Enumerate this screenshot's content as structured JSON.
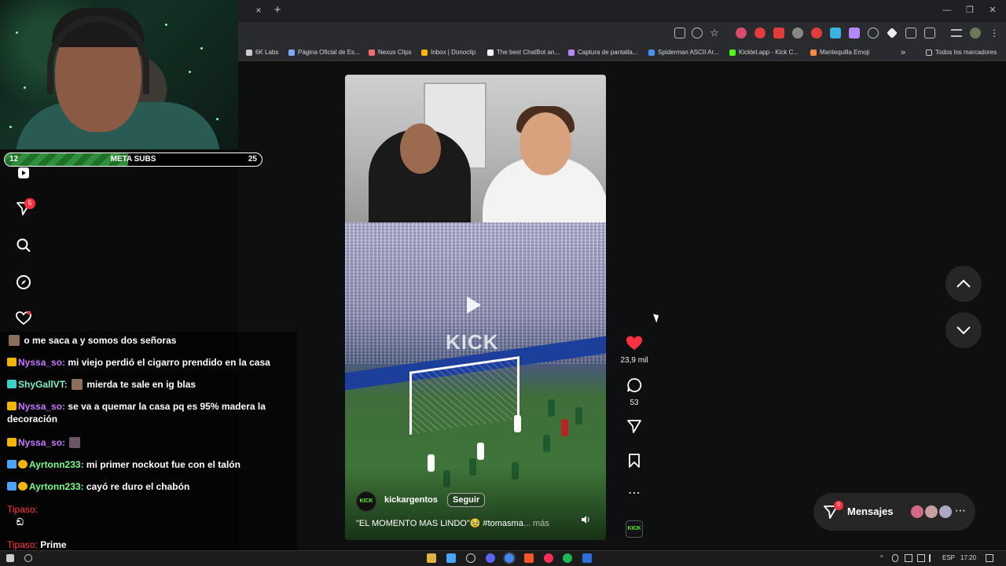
{
  "browser": {
    "tab_close": "×",
    "new_tab": "+",
    "window_controls": [
      "—",
      "❐",
      "✕"
    ],
    "bookmarks": [
      {
        "label": "6K Labs",
        "color": "#cccccc"
      },
      {
        "label": "Página Oficial de Es...",
        "color": "#7aa7ff"
      },
      {
        "label": "Nexus Clips",
        "color": "#ff6b6b"
      },
      {
        "label": "Inbox | Donoclip",
        "color": "#ffb400"
      },
      {
        "label": "The best ChatBot an...",
        "color": "#ffffff"
      },
      {
        "label": "Captura de pantalla...",
        "color": "#b388ff"
      },
      {
        "label": "Spiderman ASCII Ar...",
        "color": "#4a90ff"
      },
      {
        "label": "Kicklet.app - Kick C...",
        "color": "#53fc18"
      },
      {
        "label": "Mantequilla Emoji",
        "color": "#ff8a3d"
      }
    ],
    "bookmarks_overflow": "»",
    "all_bookmarks": "Todos los marcadores"
  },
  "overlay": {
    "meta_subs": {
      "label": "META SUBS",
      "current": "12",
      "goal": "25",
      "progress_fraction": 0.48
    },
    "notifications_badge": "5"
  },
  "chat": {
    "messages": [
      {
        "user": "",
        "user_color": "#ffffff",
        "text": "o me saca a  y somos dos señoras"
      },
      {
        "user": "Nyssa_so:",
        "user_color": "#c678ff",
        "text": "mi viejo perdió el cigarro prendido en la casa"
      },
      {
        "user": "ShyGallVT:",
        "user_color": "#7ef2c6",
        "text": "mierda te sale en ig blas"
      },
      {
        "user": "Nyssa_so:",
        "user_color": "#c678ff",
        "text": "se va a quemar la casa pq es 95% madera la decoración"
      },
      {
        "user": "Nyssa_so:",
        "user_color": "#c678ff",
        "text": ""
      },
      {
        "user": "Ayrtonn233:",
        "user_color": "#7dff8a",
        "text": "mi primer nockout fue con el talón"
      },
      {
        "user": "Ayrtonn233:",
        "user_color": "#7dff8a",
        "text": "cayó re duro el chabón"
      },
      {
        "user": "Tipaso:",
        "user_color": "#ff3b3b",
        "text": "ඞ"
      },
      {
        "user": "Tipaso:",
        "user_color": "#ff3b3b",
        "text": "Prime"
      }
    ]
  },
  "video": {
    "watermark": "KICK",
    "channel_avatar": "KICK",
    "username": "kickargentos",
    "follow": "Seguir",
    "caption": "\"EL MOMENTO MAS LINDO\"🥹 #tomasma",
    "more": "... más"
  },
  "actions": {
    "likes": "23,9 mil",
    "comments": "53",
    "kick_icon": "KICK"
  },
  "messages_panel": {
    "label": "Mensajes",
    "badge": "5"
  },
  "taskbar": {
    "lang": "ESP",
    "time": "17:20"
  },
  "colors": {
    "like": "#ff3040",
    "kick_green": "#53fc18",
    "meta_fill": "#2f8f3a"
  }
}
